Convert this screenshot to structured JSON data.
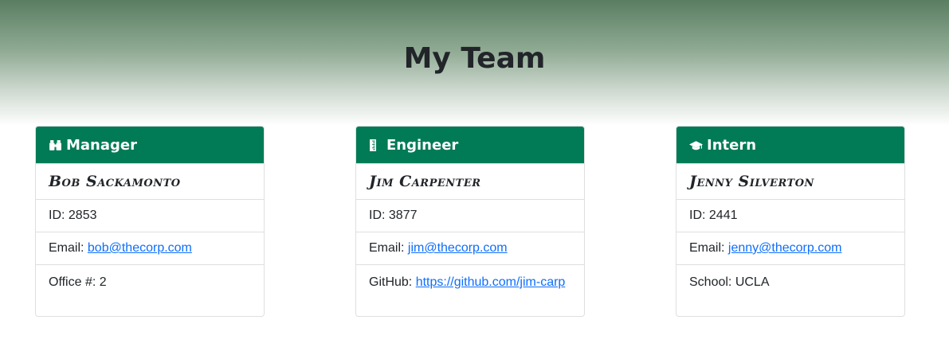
{
  "page": {
    "title": "My Team"
  },
  "colors": {
    "card_header": "#017b56",
    "link": "#0d6efd",
    "header_gradient_top": "#5a7e62"
  },
  "team": [
    {
      "role": "Manager",
      "icon": "binoculars-icon",
      "name": "Bob Sackamonto",
      "id_label": "ID: 2853",
      "email_label": "Email: ",
      "email": "bob@thecorp.com",
      "extra_label": "Office #: 2"
    },
    {
      "role": "Engineer",
      "icon": "ruler-icon",
      "name": "Jim Carpenter",
      "id_label": "ID: 3877",
      "email_label": "Email: ",
      "email": "jim@thecorp.com",
      "extra_prefix": "GitHub: ",
      "extra_link": "https://github.com/jim-carp"
    },
    {
      "role": "Intern",
      "icon": "graduation-cap-icon",
      "name": "Jenny Silverton",
      "id_label": "ID: 2441",
      "email_label": "Email: ",
      "email": "jenny@thecorp.com",
      "extra_label": "School: UCLA"
    }
  ]
}
